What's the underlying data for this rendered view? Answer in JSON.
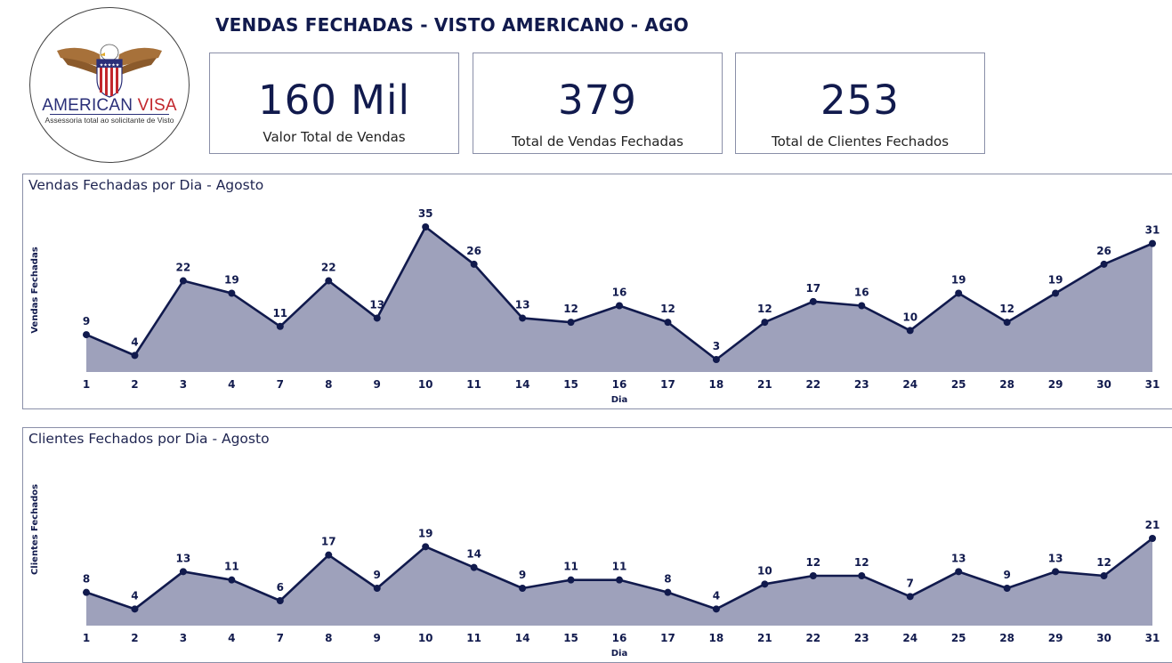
{
  "logo": {
    "brand_left": "AMERICAN ",
    "brand_right": "VISA",
    "tagline": "Assessoria total ao solicitante de Visto"
  },
  "title": "VENDAS FECHADAS - VISTO AMERICANO - AGO",
  "cards": [
    {
      "value": "160 Mil",
      "label": "Valor Total de Vendas"
    },
    {
      "value": "379",
      "label": "Total de Vendas Fechadas"
    },
    {
      "value": "253",
      "label": "Total de Clientes Fechados"
    }
  ],
  "colors": {
    "line": "#111a4d",
    "area": "#9ea1bb",
    "text": "#111a4d",
    "border": "#8a8fa8"
  },
  "chart_data": [
    {
      "type": "area",
      "title": "Vendas Fechadas por Dia - Agosto",
      "xlabel": "Dia",
      "ylabel": "Vendas Fechadas",
      "categories": [
        "1",
        "2",
        "3",
        "4",
        "7",
        "8",
        "9",
        "10",
        "11",
        "14",
        "15",
        "16",
        "17",
        "18",
        "21",
        "22",
        "23",
        "24",
        "25",
        "28",
        "29",
        "30",
        "31"
      ],
      "values": [
        9,
        4,
        22,
        19,
        11,
        22,
        13,
        35,
        26,
        13,
        12,
        16,
        12,
        3,
        12,
        17,
        16,
        10,
        19,
        12,
        19,
        26,
        31
      ],
      "ylim": [
        0,
        35
      ],
      "grid": false,
      "data_labels": true
    },
    {
      "type": "area",
      "title": "Clientes Fechados por Dia - Agosto",
      "xlabel": "Dia",
      "ylabel": "Clientes Fechados",
      "categories": [
        "1",
        "2",
        "3",
        "4",
        "7",
        "8",
        "9",
        "10",
        "11",
        "14",
        "15",
        "16",
        "17",
        "18",
        "21",
        "22",
        "23",
        "24",
        "25",
        "28",
        "29",
        "30",
        "31"
      ],
      "values": [
        8,
        4,
        13,
        11,
        6,
        17,
        9,
        19,
        14,
        9,
        11,
        11,
        8,
        4,
        10,
        12,
        12,
        7,
        13,
        9,
        13,
        12,
        21
      ],
      "ylim": [
        0,
        21
      ],
      "grid": false,
      "data_labels": true
    }
  ]
}
